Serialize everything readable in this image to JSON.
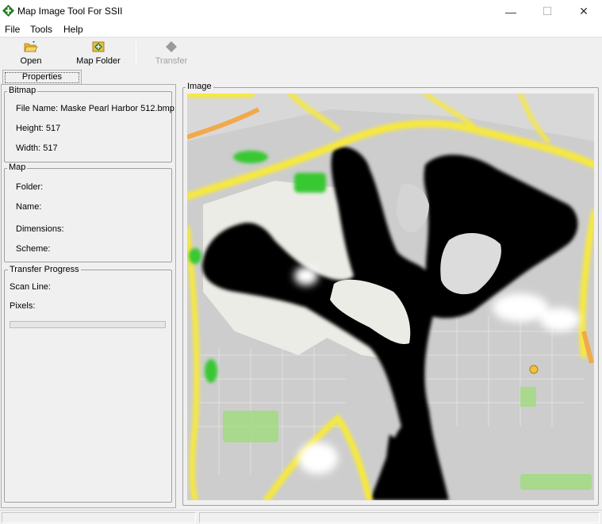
{
  "window": {
    "title": "Map Image Tool For SSII",
    "icon": "diamond-app-icon",
    "controls": {
      "minimize": "—",
      "maximize": "☐",
      "close": "✕"
    }
  },
  "menu": {
    "file": "File",
    "tools": "Tools",
    "help": "Help"
  },
  "toolbar": {
    "open": {
      "label": "Open",
      "icon": "folder-open-icon"
    },
    "map_folder": {
      "label": "Map Folder",
      "icon": "map-folder-icon"
    },
    "transfer": {
      "label": "Transfer",
      "icon": "diamond-transfer-icon",
      "enabled": false
    }
  },
  "tabs": {
    "properties": "Properties"
  },
  "bitmap": {
    "title": "Bitmap",
    "file_name": "File Name: Maske Pearl Harbor 512.bmp",
    "height": "Height: 517",
    "width": "Width: 517"
  },
  "map": {
    "title": "Map",
    "folder": "Folder:",
    "name": "Name:",
    "dimensions": "Dimensions:",
    "scheme": "Scheme:"
  },
  "transfer_progress": {
    "title": "Transfer Progress",
    "scan_line": "Scan Line:",
    "pixels": "Pixels:",
    "progress": 0
  },
  "image_panel": {
    "title": "Image"
  },
  "colors": {
    "app_icon": "#1e7a1e",
    "road_yellow": "#f7e93a",
    "land": "#e9e9e3",
    "water_mask": "#000000",
    "urban": "#cfcfcf",
    "park": "#6bd05a"
  }
}
